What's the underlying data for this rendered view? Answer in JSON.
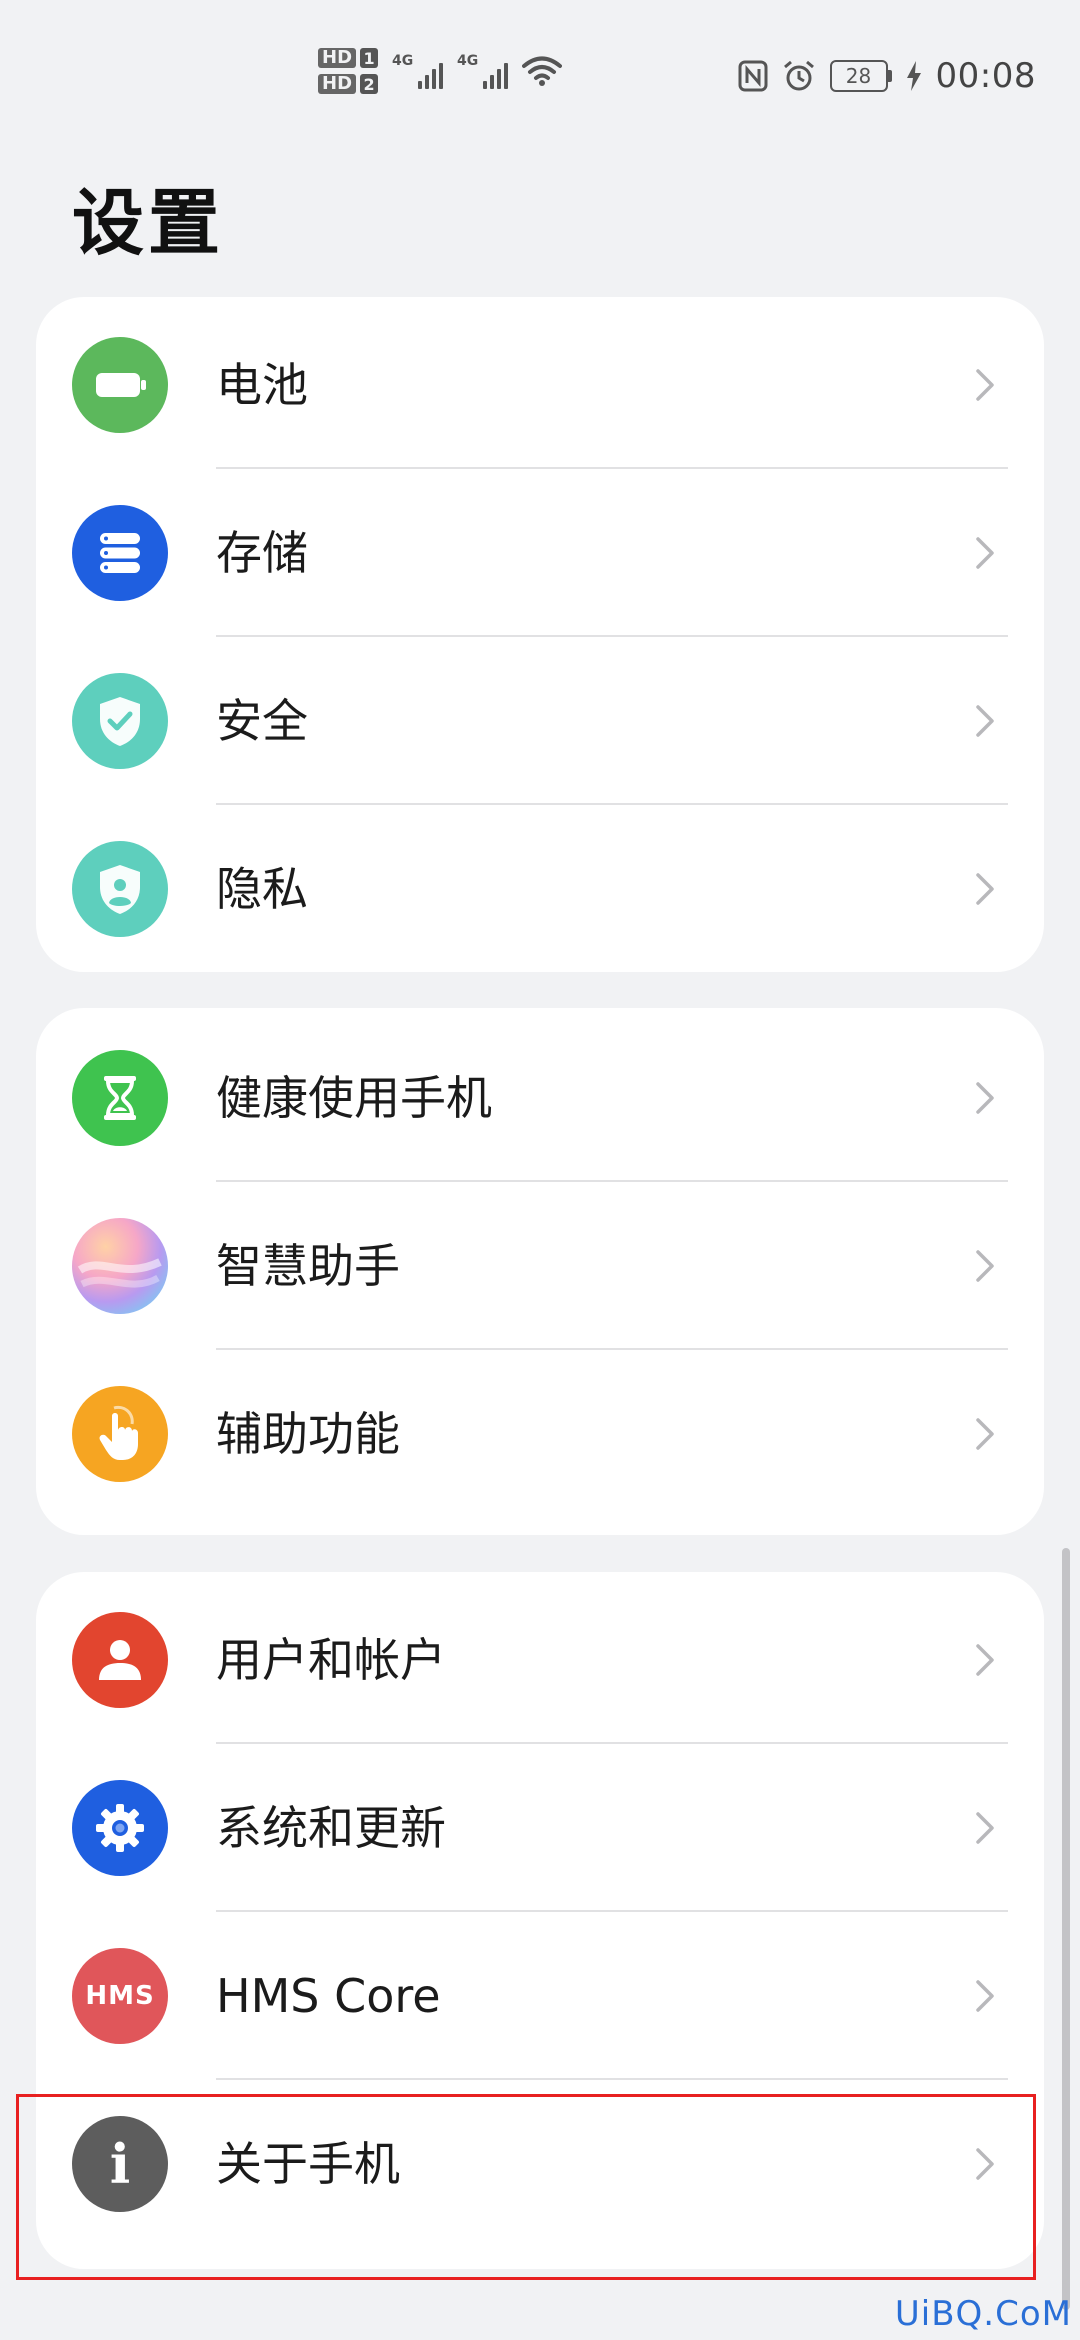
{
  "status_bar": {
    "hd_label": "HD",
    "sim1": "1",
    "sim2": "2",
    "net1": "4G",
    "net2": "4G",
    "battery_level": "28",
    "time": "00:08"
  },
  "page": {
    "title": "设置"
  },
  "groups": [
    {
      "items": [
        {
          "label": "电池",
          "icon": "battery-icon",
          "color": "#5cb85c"
        },
        {
          "label": "存储",
          "icon": "storage-icon",
          "color": "#1f5fe0"
        },
        {
          "label": "安全",
          "icon": "security-shield-icon",
          "color": "#5ecfbd"
        },
        {
          "label": "隐私",
          "icon": "privacy-shield-icon",
          "color": "#5ecfbd"
        }
      ]
    },
    {
      "items": [
        {
          "label": "健康使用手机",
          "icon": "hourglass-icon",
          "color": "#3fc34f"
        },
        {
          "label": "智慧助手",
          "icon": "assistant-gradient-icon",
          "color": "#c9a8e8"
        },
        {
          "label": "辅助功能",
          "icon": "touch-hand-icon",
          "color": "#f6a522"
        }
      ]
    },
    {
      "items": [
        {
          "label": "用户和帐户",
          "icon": "user-icon",
          "color": "#e2452f"
        },
        {
          "label": "系统和更新",
          "icon": "gear-icon",
          "color": "#1f5fe0"
        },
        {
          "label": "HMS Core",
          "icon": "hms-icon",
          "color": "#e0565a",
          "icon_text": "HMS"
        },
        {
          "label": "关于手机",
          "icon": "info-icon",
          "color": "#5d5d5d",
          "icon_text": "i"
        }
      ]
    }
  ],
  "watermark": "UiBQ.CoM"
}
